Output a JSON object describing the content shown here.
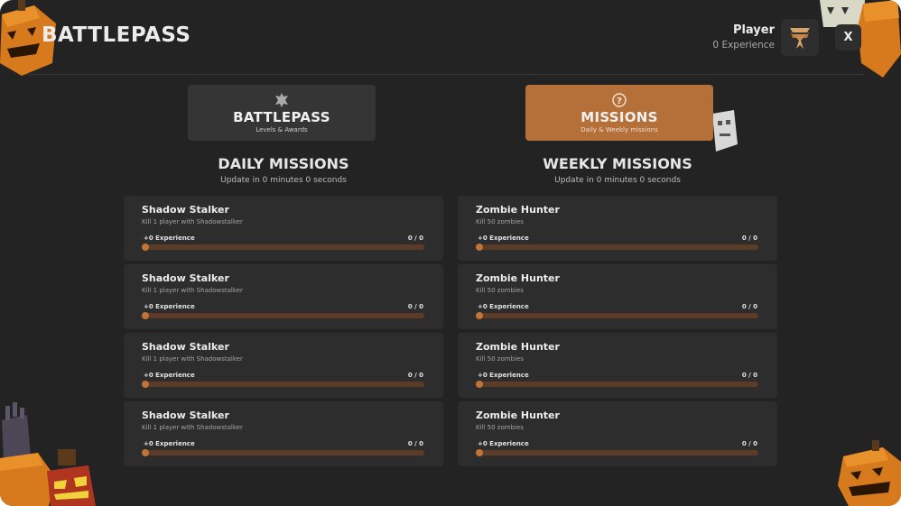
{
  "header": {
    "title": "BATTLEPASS",
    "player_name": "Player",
    "player_experience": "0 Experience",
    "close_label": "X"
  },
  "tabs": [
    {
      "title": "BATTLEPASS",
      "subtitle": "Levels & Awards",
      "icon": "gear-badge-icon",
      "active": false
    },
    {
      "title": "MISSIONS",
      "subtitle": "Daily & Weekly missions",
      "icon": "question-circle-icon",
      "active": true
    }
  ],
  "daily": {
    "title": "DAILY MISSIONS",
    "update": "Update in 0 minutes 0 seconds",
    "missions": [
      {
        "name": "Shadow Stalker",
        "description": "Kill 1 player with Shadowstalker",
        "reward": "+0 Experience",
        "count": "0 / 0",
        "progress": 0
      },
      {
        "name": "Shadow Stalker",
        "description": "Kill 1 player with Shadowstalker",
        "reward": "+0 Experience",
        "count": "0 / 0",
        "progress": 0
      },
      {
        "name": "Shadow Stalker",
        "description": "Kill 1 player with Shadowstalker",
        "reward": "+0 Experience",
        "count": "0 / 0",
        "progress": 0
      },
      {
        "name": "Shadow Stalker",
        "description": "Kill 1 player with Shadowstalker",
        "reward": "+0 Experience",
        "count": "0 / 0",
        "progress": 0
      }
    ]
  },
  "weekly": {
    "title": "WEEKLY MISSIONS",
    "update": "Update in 0 minutes 0 seconds",
    "missions": [
      {
        "name": "Zombie Hunter",
        "description": "Kill 50 zombies",
        "reward": "+0 Experience",
        "count": "0 / 0",
        "progress": 0
      },
      {
        "name": "Zombie Hunter",
        "description": "Kill 50 zombies",
        "reward": "+0 Experience",
        "count": "0 / 0",
        "progress": 0
      },
      {
        "name": "Zombie Hunter",
        "description": "Kill 50 zombies",
        "reward": "+0 Experience",
        "count": "0 / 0",
        "progress": 0
      },
      {
        "name": "Zombie Hunter",
        "description": "Kill 50 zombies",
        "reward": "+0 Experience",
        "count": "0 / 0",
        "progress": 0
      }
    ]
  },
  "colors": {
    "background": "#232323",
    "card": "#2d2d2d",
    "accent": "#b5703a",
    "bar_track": "#5c3c26",
    "bar_fill": "#c27437"
  }
}
